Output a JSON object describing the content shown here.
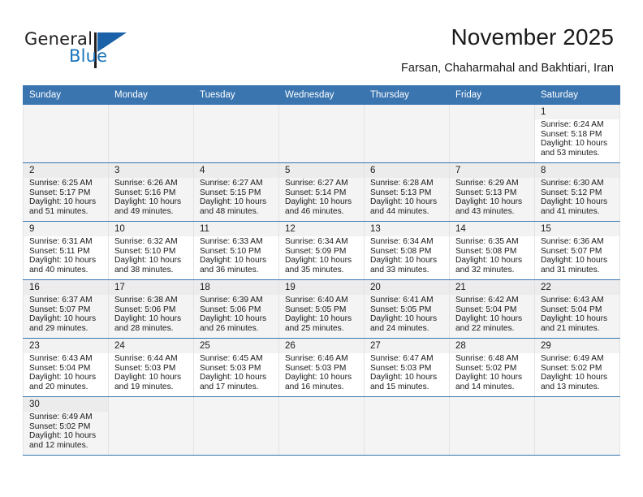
{
  "brand": {
    "name_top": "General",
    "name_bottom": "Blue",
    "accent_color": "#1b75bb",
    "triangle_icon": "brand-triangle-icon"
  },
  "header": {
    "title": "November 2025",
    "subtitle": "Farsan, Chaharmahal and Bakhtiari, Iran"
  },
  "calendar": {
    "header_bg": "#3a75b0",
    "weekdays": [
      "Sunday",
      "Monday",
      "Tuesday",
      "Wednesday",
      "Thursday",
      "Friday",
      "Saturday"
    ],
    "weeks": [
      [
        {
          "day": "",
          "sunrise": "",
          "sunset": "",
          "daylight1": "",
          "daylight2": "",
          "empty": true
        },
        {
          "day": "",
          "sunrise": "",
          "sunset": "",
          "daylight1": "",
          "daylight2": "",
          "empty": true
        },
        {
          "day": "",
          "sunrise": "",
          "sunset": "",
          "daylight1": "",
          "daylight2": "",
          "empty": true
        },
        {
          "day": "",
          "sunrise": "",
          "sunset": "",
          "daylight1": "",
          "daylight2": "",
          "empty": true
        },
        {
          "day": "",
          "sunrise": "",
          "sunset": "",
          "daylight1": "",
          "daylight2": "",
          "empty": true
        },
        {
          "day": "",
          "sunrise": "",
          "sunset": "",
          "daylight1": "",
          "daylight2": "",
          "empty": true
        },
        {
          "day": "1",
          "sunrise": "Sunrise: 6:24 AM",
          "sunset": "Sunset: 5:18 PM",
          "daylight1": "Daylight: 10 hours",
          "daylight2": "and 53 minutes."
        }
      ],
      [
        {
          "day": "2",
          "sunrise": "Sunrise: 6:25 AM",
          "sunset": "Sunset: 5:17 PM",
          "daylight1": "Daylight: 10 hours",
          "daylight2": "and 51 minutes."
        },
        {
          "day": "3",
          "sunrise": "Sunrise: 6:26 AM",
          "sunset": "Sunset: 5:16 PM",
          "daylight1": "Daylight: 10 hours",
          "daylight2": "and 49 minutes."
        },
        {
          "day": "4",
          "sunrise": "Sunrise: 6:27 AM",
          "sunset": "Sunset: 5:15 PM",
          "daylight1": "Daylight: 10 hours",
          "daylight2": "and 48 minutes."
        },
        {
          "day": "5",
          "sunrise": "Sunrise: 6:27 AM",
          "sunset": "Sunset: 5:14 PM",
          "daylight1": "Daylight: 10 hours",
          "daylight2": "and 46 minutes."
        },
        {
          "day": "6",
          "sunrise": "Sunrise: 6:28 AM",
          "sunset": "Sunset: 5:13 PM",
          "daylight1": "Daylight: 10 hours",
          "daylight2": "and 44 minutes."
        },
        {
          "day": "7",
          "sunrise": "Sunrise: 6:29 AM",
          "sunset": "Sunset: 5:13 PM",
          "daylight1": "Daylight: 10 hours",
          "daylight2": "and 43 minutes."
        },
        {
          "day": "8",
          "sunrise": "Sunrise: 6:30 AM",
          "sunset": "Sunset: 5:12 PM",
          "daylight1": "Daylight: 10 hours",
          "daylight2": "and 41 minutes."
        }
      ],
      [
        {
          "day": "9",
          "sunrise": "Sunrise: 6:31 AM",
          "sunset": "Sunset: 5:11 PM",
          "daylight1": "Daylight: 10 hours",
          "daylight2": "and 40 minutes."
        },
        {
          "day": "10",
          "sunrise": "Sunrise: 6:32 AM",
          "sunset": "Sunset: 5:10 PM",
          "daylight1": "Daylight: 10 hours",
          "daylight2": "and 38 minutes."
        },
        {
          "day": "11",
          "sunrise": "Sunrise: 6:33 AM",
          "sunset": "Sunset: 5:10 PM",
          "daylight1": "Daylight: 10 hours",
          "daylight2": "and 36 minutes."
        },
        {
          "day": "12",
          "sunrise": "Sunrise: 6:34 AM",
          "sunset": "Sunset: 5:09 PM",
          "daylight1": "Daylight: 10 hours",
          "daylight2": "and 35 minutes."
        },
        {
          "day": "13",
          "sunrise": "Sunrise: 6:34 AM",
          "sunset": "Sunset: 5:08 PM",
          "daylight1": "Daylight: 10 hours",
          "daylight2": "and 33 minutes."
        },
        {
          "day": "14",
          "sunrise": "Sunrise: 6:35 AM",
          "sunset": "Sunset: 5:08 PM",
          "daylight1": "Daylight: 10 hours",
          "daylight2": "and 32 minutes."
        },
        {
          "day": "15",
          "sunrise": "Sunrise: 6:36 AM",
          "sunset": "Sunset: 5:07 PM",
          "daylight1": "Daylight: 10 hours",
          "daylight2": "and 31 minutes."
        }
      ],
      [
        {
          "day": "16",
          "sunrise": "Sunrise: 6:37 AM",
          "sunset": "Sunset: 5:07 PM",
          "daylight1": "Daylight: 10 hours",
          "daylight2": "and 29 minutes."
        },
        {
          "day": "17",
          "sunrise": "Sunrise: 6:38 AM",
          "sunset": "Sunset: 5:06 PM",
          "daylight1": "Daylight: 10 hours",
          "daylight2": "and 28 minutes."
        },
        {
          "day": "18",
          "sunrise": "Sunrise: 6:39 AM",
          "sunset": "Sunset: 5:06 PM",
          "daylight1": "Daylight: 10 hours",
          "daylight2": "and 26 minutes."
        },
        {
          "day": "19",
          "sunrise": "Sunrise: 6:40 AM",
          "sunset": "Sunset: 5:05 PM",
          "daylight1": "Daylight: 10 hours",
          "daylight2": "and 25 minutes."
        },
        {
          "day": "20",
          "sunrise": "Sunrise: 6:41 AM",
          "sunset": "Sunset: 5:05 PM",
          "daylight1": "Daylight: 10 hours",
          "daylight2": "and 24 minutes."
        },
        {
          "day": "21",
          "sunrise": "Sunrise: 6:42 AM",
          "sunset": "Sunset: 5:04 PM",
          "daylight1": "Daylight: 10 hours",
          "daylight2": "and 22 minutes."
        },
        {
          "day": "22",
          "sunrise": "Sunrise: 6:43 AM",
          "sunset": "Sunset: 5:04 PM",
          "daylight1": "Daylight: 10 hours",
          "daylight2": "and 21 minutes."
        }
      ],
      [
        {
          "day": "23",
          "sunrise": "Sunrise: 6:43 AM",
          "sunset": "Sunset: 5:04 PM",
          "daylight1": "Daylight: 10 hours",
          "daylight2": "and 20 minutes."
        },
        {
          "day": "24",
          "sunrise": "Sunrise: 6:44 AM",
          "sunset": "Sunset: 5:03 PM",
          "daylight1": "Daylight: 10 hours",
          "daylight2": "and 19 minutes."
        },
        {
          "day": "25",
          "sunrise": "Sunrise: 6:45 AM",
          "sunset": "Sunset: 5:03 PM",
          "daylight1": "Daylight: 10 hours",
          "daylight2": "and 17 minutes."
        },
        {
          "day": "26",
          "sunrise": "Sunrise: 6:46 AM",
          "sunset": "Sunset: 5:03 PM",
          "daylight1": "Daylight: 10 hours",
          "daylight2": "and 16 minutes."
        },
        {
          "day": "27",
          "sunrise": "Sunrise: 6:47 AM",
          "sunset": "Sunset: 5:03 PM",
          "daylight1": "Daylight: 10 hours",
          "daylight2": "and 15 minutes."
        },
        {
          "day": "28",
          "sunrise": "Sunrise: 6:48 AM",
          "sunset": "Sunset: 5:02 PM",
          "daylight1": "Daylight: 10 hours",
          "daylight2": "and 14 minutes."
        },
        {
          "day": "29",
          "sunrise": "Sunrise: 6:49 AM",
          "sunset": "Sunset: 5:02 PM",
          "daylight1": "Daylight: 10 hours",
          "daylight2": "and 13 minutes."
        }
      ],
      [
        {
          "day": "30",
          "sunrise": "Sunrise: 6:49 AM",
          "sunset": "Sunset: 5:02 PM",
          "daylight1": "Daylight: 10 hours",
          "daylight2": "and 12 minutes."
        },
        {
          "day": "",
          "sunrise": "",
          "sunset": "",
          "daylight1": "",
          "daylight2": "",
          "empty": true
        },
        {
          "day": "",
          "sunrise": "",
          "sunset": "",
          "daylight1": "",
          "daylight2": "",
          "empty": true
        },
        {
          "day": "",
          "sunrise": "",
          "sunset": "",
          "daylight1": "",
          "daylight2": "",
          "empty": true
        },
        {
          "day": "",
          "sunrise": "",
          "sunset": "",
          "daylight1": "",
          "daylight2": "",
          "empty": true
        },
        {
          "day": "",
          "sunrise": "",
          "sunset": "",
          "daylight1": "",
          "daylight2": "",
          "empty": true
        },
        {
          "day": "",
          "sunrise": "",
          "sunset": "",
          "daylight1": "",
          "daylight2": "",
          "empty": true
        }
      ]
    ]
  }
}
